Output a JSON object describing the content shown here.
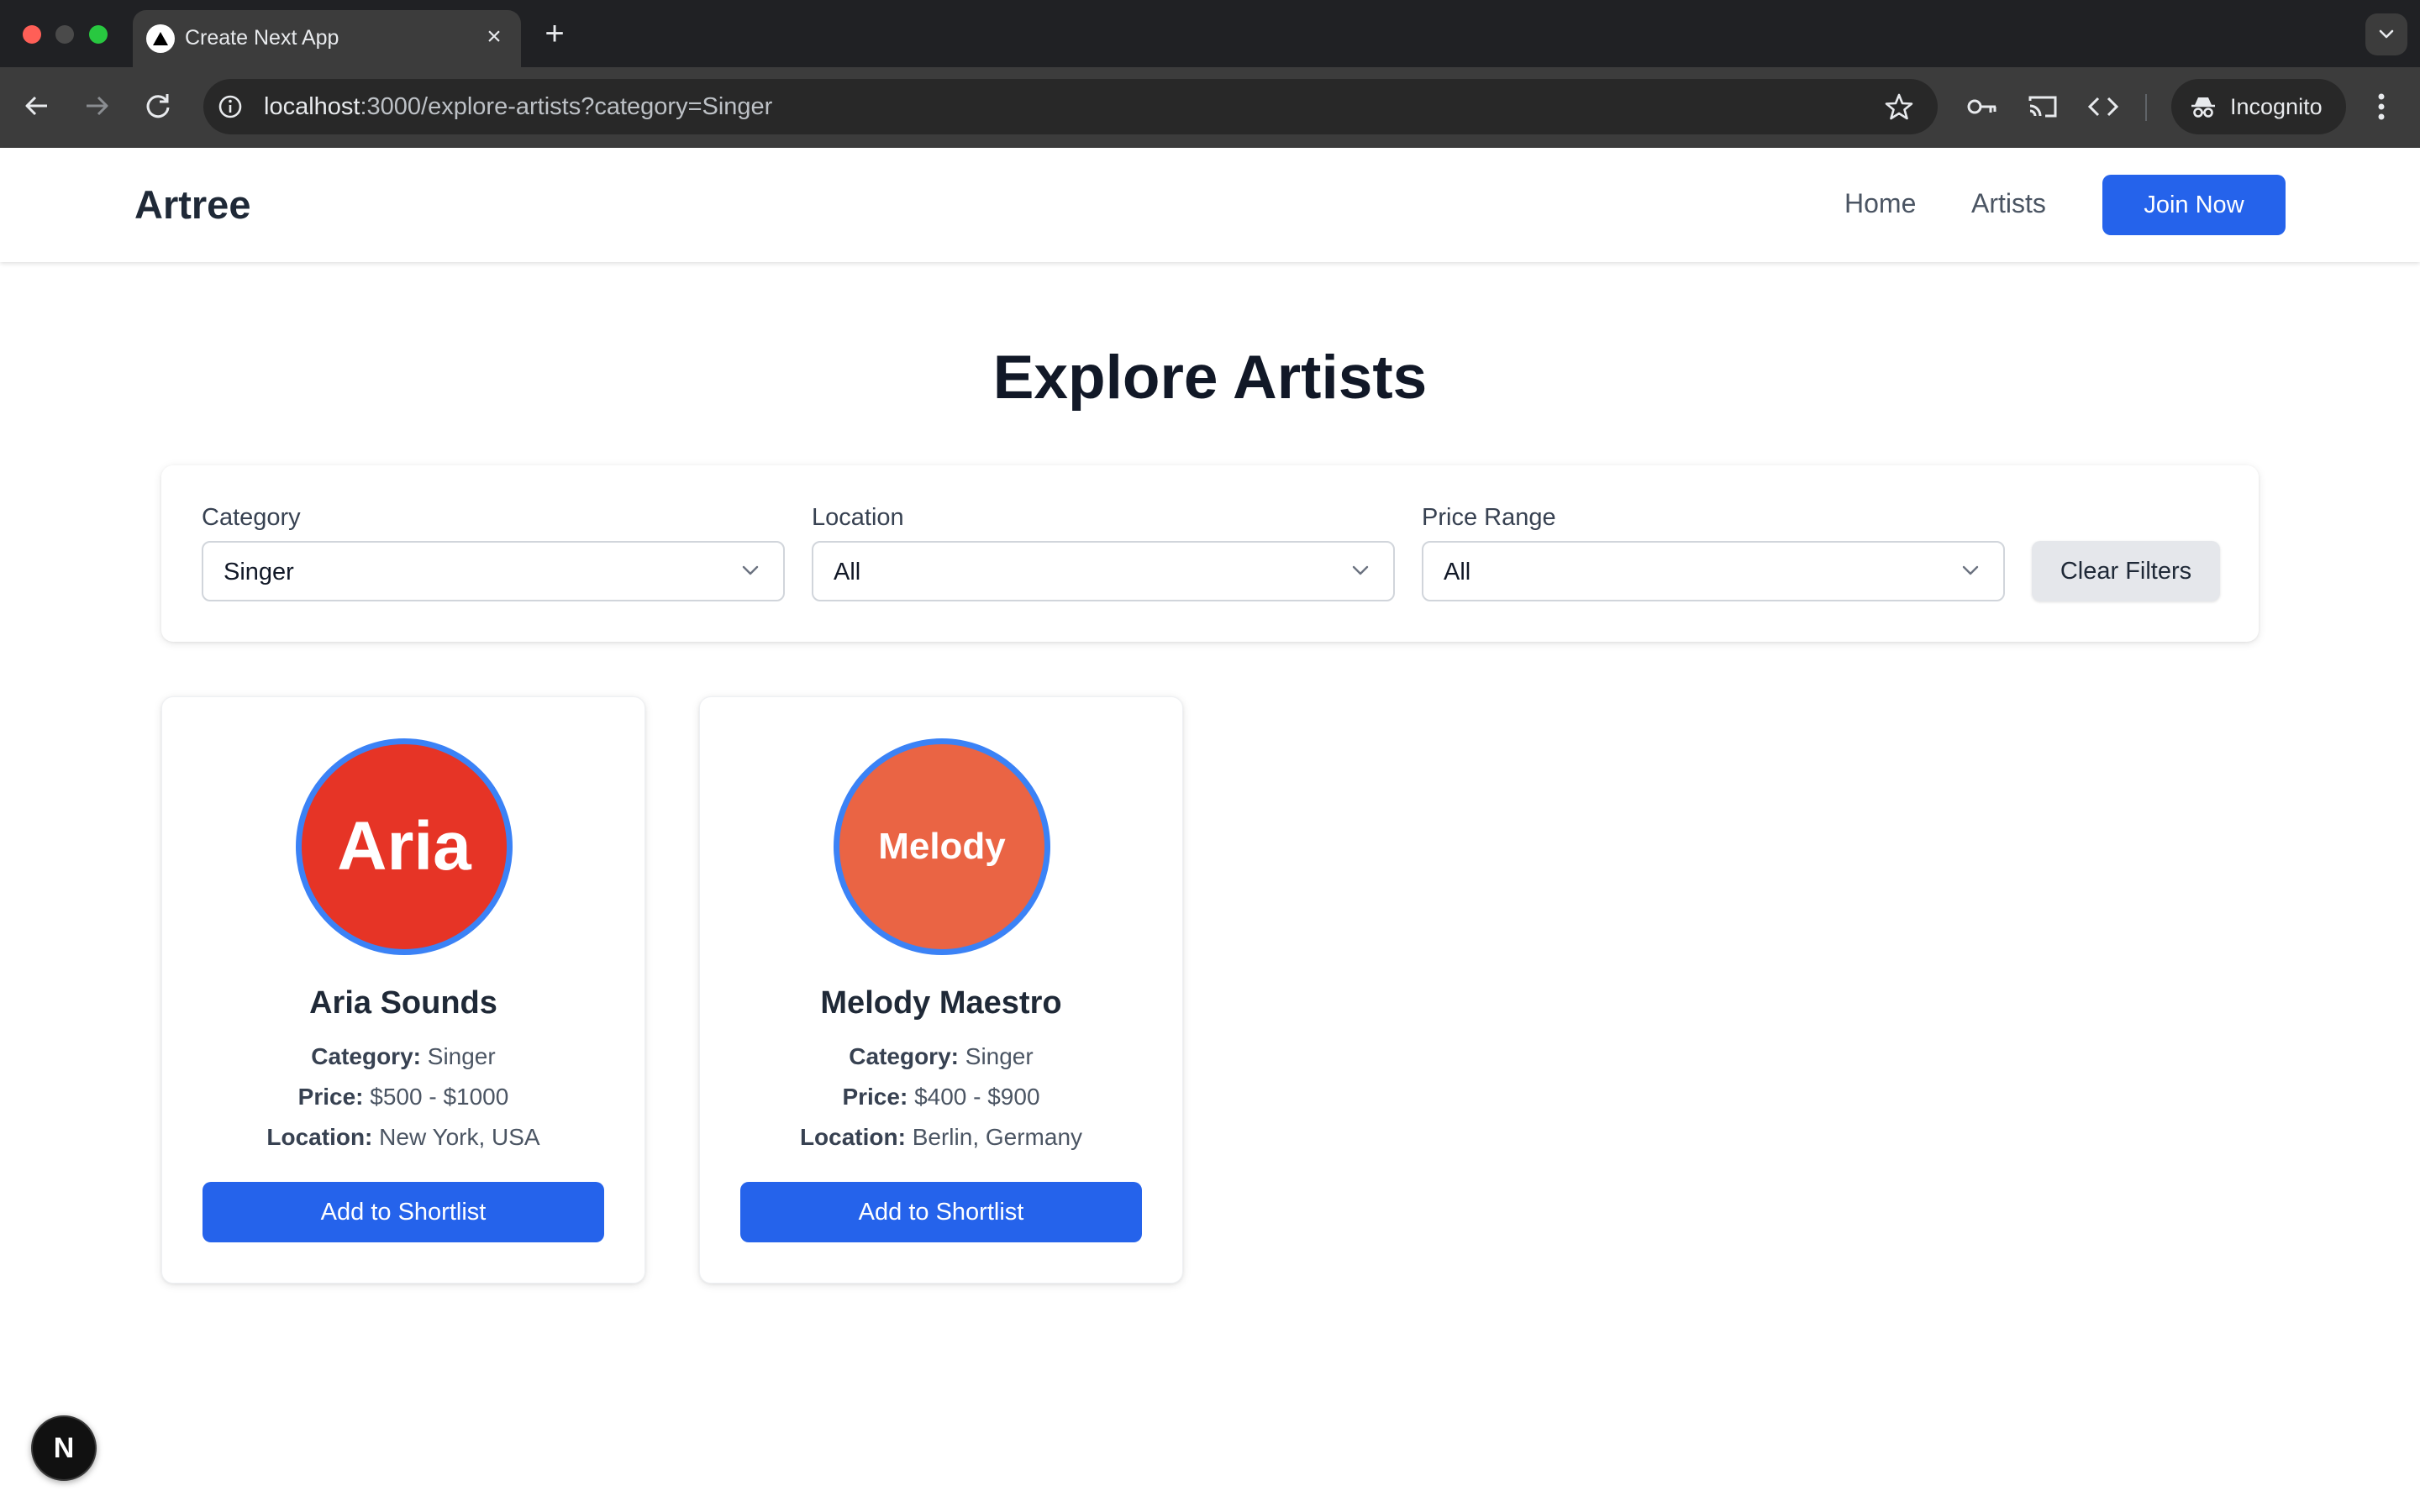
{
  "browser": {
    "tab_title": "Create Next App",
    "url_host": "localhost",
    "url_rest": ":3000/explore-artists?category=Singer",
    "incognito_label": "Incognito"
  },
  "site": {
    "brand": "Artree",
    "nav": {
      "home": "Home",
      "artists": "Artists"
    },
    "cta": "Join Now"
  },
  "page": {
    "title": "Explore Artists"
  },
  "filters": {
    "category": {
      "label": "Category",
      "value": "Singer"
    },
    "location": {
      "label": "Location",
      "value": "All"
    },
    "price": {
      "label": "Price Range",
      "value": "All"
    },
    "clear_label": "Clear Filters"
  },
  "labels": {
    "category": "Category:",
    "price": "Price:",
    "location": "Location:",
    "shortlist": "Add to Shortlist"
  },
  "artists": [
    {
      "avatar_text": "Aria",
      "avatar_color": "#e63426",
      "name": "Aria Sounds",
      "category": "Singer",
      "price": "$500 - $1000",
      "location": "New York, USA"
    },
    {
      "avatar_text": "Melody",
      "avatar_color": "#ea6444",
      "name": "Melody Maestro",
      "category": "Singer",
      "price": "$400 - $900",
      "location": "Berlin, Germany"
    }
  ],
  "dev_badge": "N"
}
